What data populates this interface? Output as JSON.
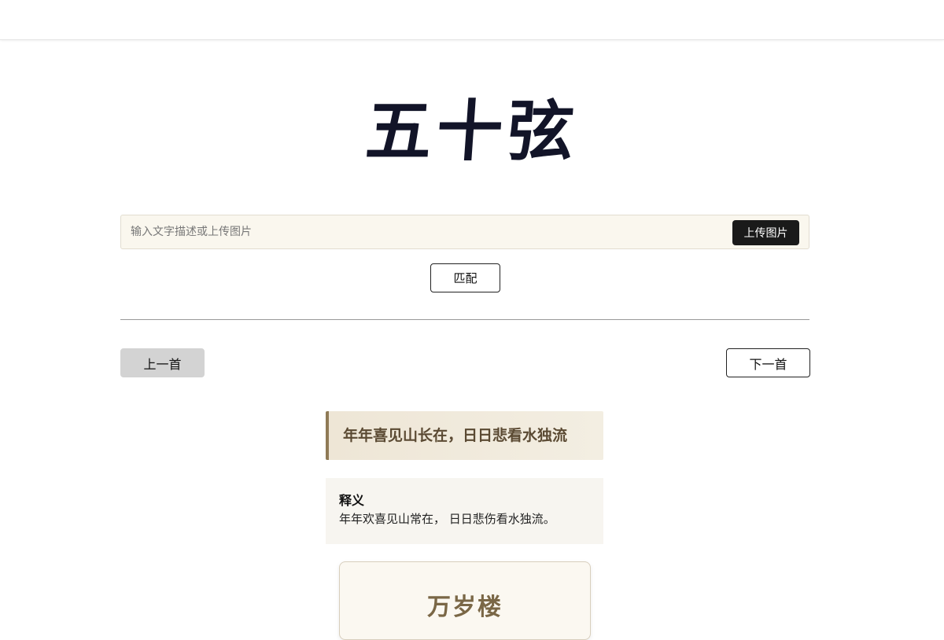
{
  "app": {
    "logo_text": "五十弦"
  },
  "search": {
    "placeholder": "输入文字描述或上传图片",
    "value": "",
    "upload_label": "上传图片",
    "match_label": "匹配"
  },
  "nav": {
    "prev_label": "上一首",
    "next_label": "下一首"
  },
  "result": {
    "verse": "年年喜见山长在，日日悲看水独流",
    "meaning_title": "释义",
    "meaning_text": "年年欢喜见山常在， 日日悲伤看水独流。",
    "poem_title": "万岁楼"
  },
  "colors": {
    "logo": "#121428",
    "verse_accent": "#8f7a56",
    "poem_title": "#7a6746",
    "upload_button": "#1a1a1a"
  }
}
